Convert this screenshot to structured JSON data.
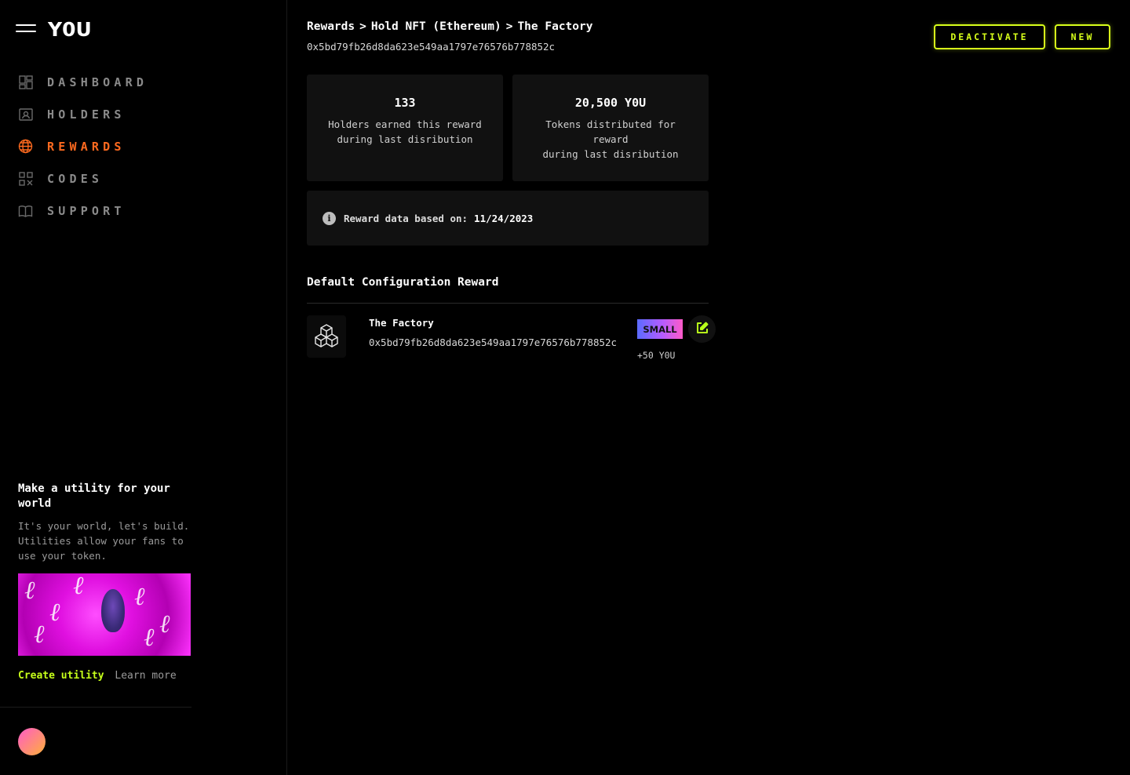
{
  "app": {
    "logo": "Y0U",
    "menu_icon": "hamburger-icon"
  },
  "sidebar": {
    "items": [
      {
        "label": "DASHBOARD",
        "icon": "dashboard-icon",
        "active": false
      },
      {
        "label": "HOLDERS",
        "icon": "holders-icon",
        "active": false
      },
      {
        "label": "REWARDS",
        "icon": "globe-icon",
        "active": true
      },
      {
        "label": "CODES",
        "icon": "qr-code-icon",
        "active": false
      },
      {
        "label": "SUPPORT",
        "icon": "book-icon",
        "active": false
      }
    ],
    "promo": {
      "title": "Make a utility for your world",
      "text": "It's your world, let's build. Utilities allow your fans to use your token.",
      "create_link": "Create utility",
      "learn_link": "Learn more"
    }
  },
  "header": {
    "breadcrumb": [
      "Rewards",
      "Hold NFT (Ethereum)",
      "The Factory"
    ],
    "breadcrumb_separator": ">",
    "address": "0x5bd79fb26d8da623e549aa1797e76576b778852c",
    "deactivate_label": "DEACTIVATE",
    "new_label": "NEW"
  },
  "stats": [
    {
      "value": "133",
      "label": "Holders earned this reward\nduring last disribution"
    },
    {
      "value": "20,500 Y0U",
      "label": "Tokens distributed for\nreward\nduring last disribution"
    }
  ],
  "info": {
    "icon": "info-icon",
    "label": "Reward data based on:",
    "date": "11/24/2023"
  },
  "section": {
    "title": "Default Configuration Reward"
  },
  "reward": {
    "name": "The Factory",
    "address": "0x5bd79fb26d8da623e549aa1797e76576b778852c",
    "badge": "SMALL",
    "amount": "+50 Y0U",
    "icon": "cubes-icon",
    "edit_icon": "edit-icon"
  },
  "colors": {
    "accent_orange": "#ff6a1f",
    "accent_lime": "#d8ff1a",
    "nav_inactive": "#8a8a8a",
    "card_bg": "#111111"
  }
}
